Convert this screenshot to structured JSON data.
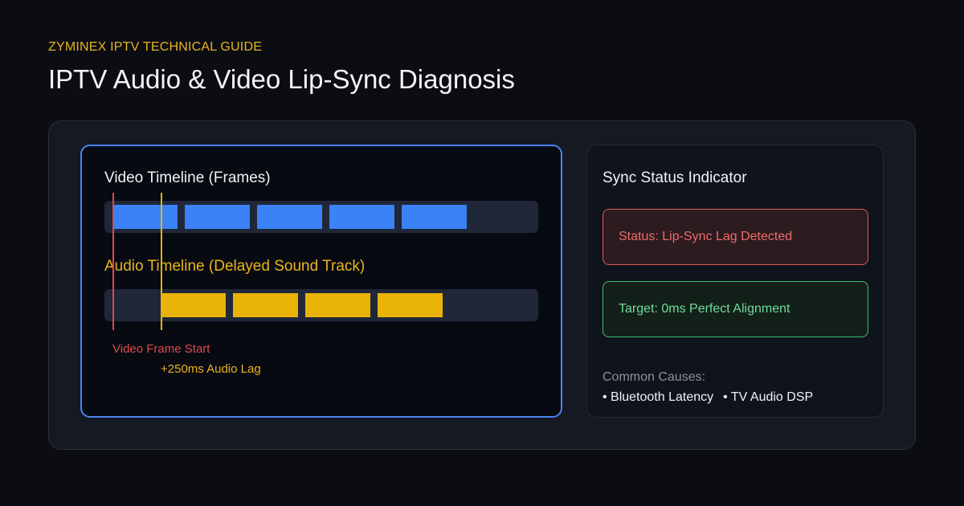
{
  "header": {
    "eyebrow": "ZYMINEX IPTV TECHNICAL GUIDE",
    "title": "IPTV Audio & Video Lip-Sync Diagnosis"
  },
  "diagram": {
    "video_label": "Video Timeline (Frames)",
    "audio_label": "Audio Timeline (Delayed Sound Track)",
    "video_marker_label": "Video Frame Start",
    "audio_marker_label": "+250ms Audio Lag",
    "video_frame_count": 5,
    "audio_frame_count": 4
  },
  "side": {
    "title": "Sync Status Indicator",
    "status_lag": "Status: Lip-Sync Lag Detected",
    "status_target": "Target: 0ms Perfect Alignment",
    "causes_title": "Common Causes:",
    "causes": [
      "• Bluetooth Latency",
      "• TV Audio DSP"
    ]
  },
  "colors": {
    "accent_gold": "#eab308",
    "video_blue": "#3b82f6",
    "alert_red": "#e04848",
    "ok_green": "#3fbf70"
  }
}
